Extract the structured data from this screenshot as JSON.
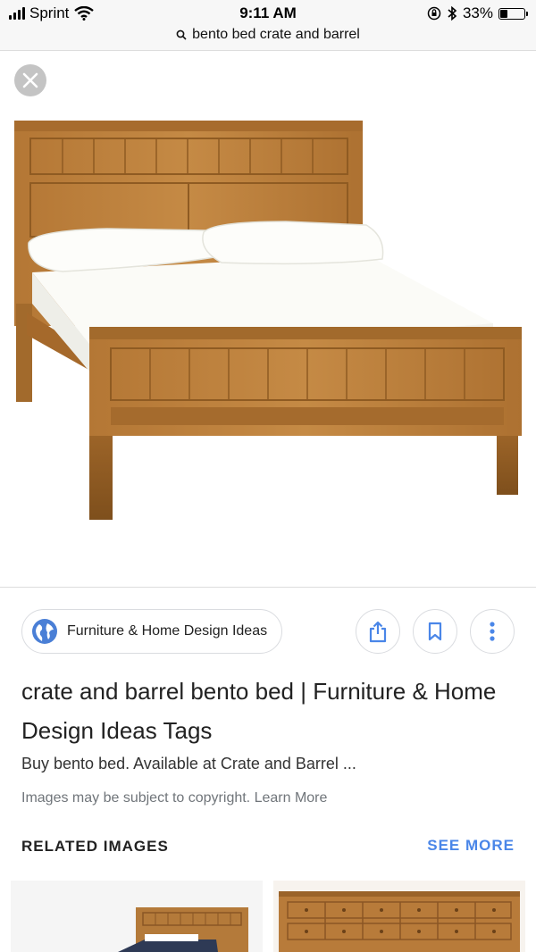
{
  "status_bar": {
    "carrier": "Sprint",
    "time": "9:11 AM",
    "battery": "33%",
    "battery_level": 0.33
  },
  "address_bar": {
    "query": "bento bed crate and barrel"
  },
  "viewer": {
    "close_icon": "close-icon"
  },
  "result": {
    "source_name": "Furniture & Home Design Ideas",
    "title": "crate and barrel bento bed | Furniture & Home Design Ideas Tags",
    "description": "Buy bento bed. Available at Crate and Barrel ...",
    "copyright_text": "Images may be subject to copyright.",
    "learn_more": "Learn More"
  },
  "related": {
    "label": "RELATED IMAGES",
    "see_more": "SEE MORE"
  },
  "colors": {
    "accent_blue": "#4a86e8",
    "wood": "#b97d36",
    "wood_dark": "#8f5b22"
  }
}
